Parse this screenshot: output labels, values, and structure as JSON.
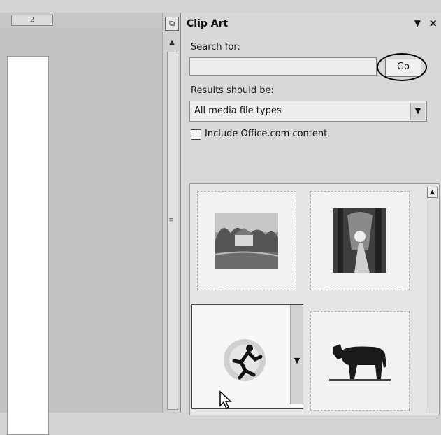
{
  "ruler": {
    "page_indicator": "2"
  },
  "pane": {
    "title": "Clip Art",
    "dropdown_icon": "▼",
    "close_icon": "×"
  },
  "search": {
    "label": "Search for:",
    "value": "",
    "placeholder": "",
    "go_label": "Go"
  },
  "results": {
    "label": "Results should be:",
    "selected": "All media file types"
  },
  "office": {
    "checked": false,
    "label": "Include Office.com content"
  },
  "thumbnails": [
    {
      "icon": "landscape-photo-icon"
    },
    {
      "icon": "forest-path-photo-icon"
    },
    {
      "icon": "running-figure-clipart-icon"
    },
    {
      "icon": "cow-clipart-icon"
    }
  ]
}
